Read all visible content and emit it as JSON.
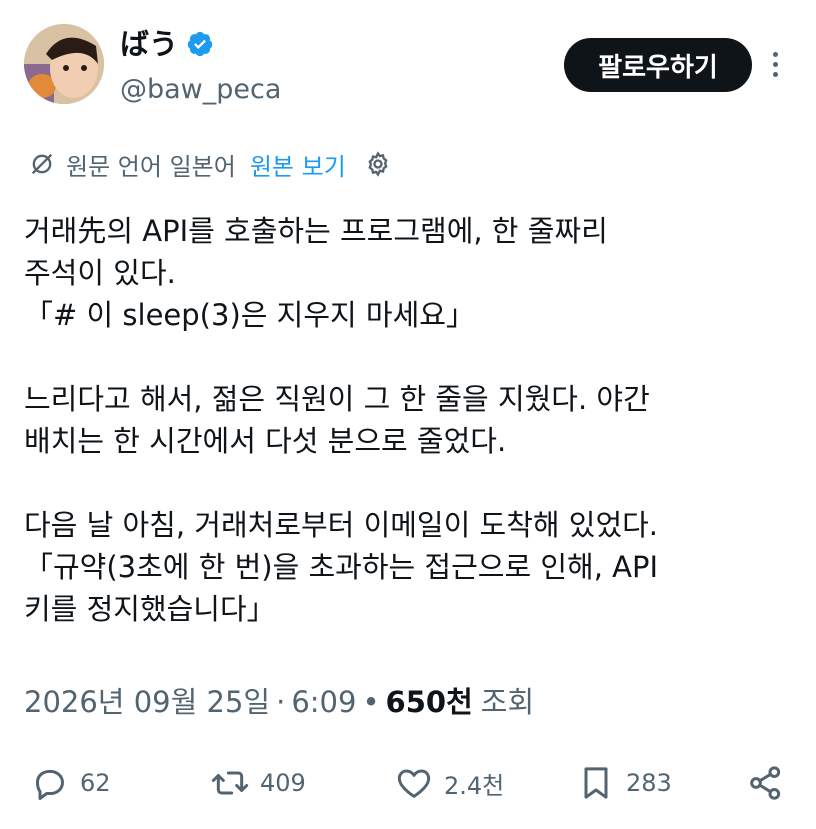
{
  "author": {
    "display_name": "ばう",
    "handle": "@baw_peca",
    "verified_icon": "verified-badge-icon",
    "verified_color": "#1d9bf0"
  },
  "follow_label": "팔로우하기",
  "translation": {
    "notice": "원문 언어 일본어",
    "show_original": "원본 보기"
  },
  "tweet_text": "거래先의 API를 호출하는 프로그램에, 한 줄짜리\n주석이 있다.\n「# 이 sleep(3)은 지우지 마세요」\n\n느리다고 해서, 젊은 직원이 그 한 줄을 지웠다. 야간\n배치는 한 시간에서 다섯 분으로 줄었다.\n\n다음 날 아침, 거래처로부터 이메일이 도착해 있었다.\n「규약(3초에 한 번)을 초과하는 접근으로 인해, API\n키를 정지했습니다」",
  "meta": {
    "date": "2026년 09월 25일",
    "time": "6:09",
    "views_count": "650천",
    "views_label": "조회"
  },
  "actions": {
    "replies": "62",
    "reposts": "409",
    "likes": "2.4천",
    "bookmarks": "283"
  },
  "colors": {
    "text": "#0f1419",
    "secondary": "#536471",
    "link": "#1d9bf0"
  }
}
